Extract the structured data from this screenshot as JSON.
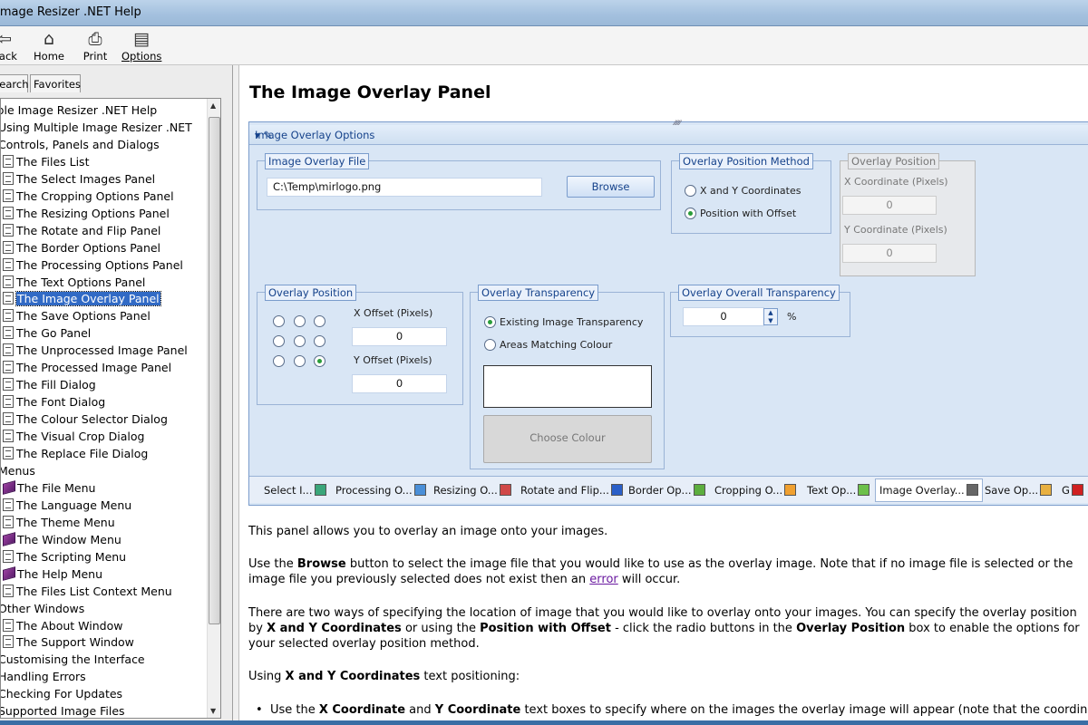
{
  "window": {
    "title": "Image Resizer .NET Help"
  },
  "toolbar": {
    "back": "Back",
    "home": "Home",
    "print": "Print",
    "options": "Options"
  },
  "nav_tabs": {
    "search": "Search",
    "favorites": "Favorites"
  },
  "tree": [
    {
      "label": "Multiple Image Resizer .NET Help",
      "type": "text"
    },
    {
      "label": "Using Multiple Image Resizer .NET",
      "type": "text"
    },
    {
      "label": "Controls, Panels and Dialogs",
      "type": "text"
    },
    {
      "label": "The Files List",
      "type": "page"
    },
    {
      "label": "The Select Images Panel",
      "type": "page"
    },
    {
      "label": "The Cropping Options Panel",
      "type": "page"
    },
    {
      "label": "The Resizing Options Panel",
      "type": "page"
    },
    {
      "label": "The Rotate and Flip Panel",
      "type": "page"
    },
    {
      "label": "The Border Options Panel",
      "type": "page"
    },
    {
      "label": "The Processing Options Panel",
      "type": "page"
    },
    {
      "label": "The Text Options Panel",
      "type": "page"
    },
    {
      "label": "The Image Overlay Panel",
      "type": "page",
      "selected": true
    },
    {
      "label": "The Save Options Panel",
      "type": "page"
    },
    {
      "label": "The Go Panel",
      "type": "page"
    },
    {
      "label": "The Unprocessed Image Panel",
      "type": "page"
    },
    {
      "label": "The Processed Image Panel",
      "type": "page"
    },
    {
      "label": "The Fill Dialog",
      "type": "page"
    },
    {
      "label": "The Font Dialog",
      "type": "page"
    },
    {
      "label": "The Colour Selector Dialog",
      "type": "page"
    },
    {
      "label": "The Visual Crop Dialog",
      "type": "page"
    },
    {
      "label": "The Replace File Dialog",
      "type": "page"
    },
    {
      "label": "Menus",
      "type": "text"
    },
    {
      "label": "The File Menu",
      "type": "book"
    },
    {
      "label": "The Language Menu",
      "type": "page"
    },
    {
      "label": "The Theme Menu",
      "type": "page"
    },
    {
      "label": "The Window Menu",
      "type": "book"
    },
    {
      "label": "The Scripting Menu",
      "type": "page"
    },
    {
      "label": "The Help Menu",
      "type": "book"
    },
    {
      "label": "The Files List Context Menu",
      "type": "page"
    },
    {
      "label": "Other Windows",
      "type": "text"
    },
    {
      "label": "The About Window",
      "type": "page"
    },
    {
      "label": "The Support Window",
      "type": "page"
    },
    {
      "label": "Customising the Interface",
      "type": "text"
    },
    {
      "label": "Handling Errors",
      "type": "text"
    },
    {
      "label": "Checking For Updates",
      "type": "text"
    },
    {
      "label": "Supported Image Files",
      "type": "text"
    }
  ],
  "content": {
    "heading": "The Image Overlay Panel",
    "panel": {
      "title": "Image Overlay Options",
      "overlay_file": {
        "legend": "Image Overlay File",
        "path": "C:\\Temp\\mirlogo.png",
        "browse": "Browse"
      },
      "position_method": {
        "legend": "Overlay Position Method",
        "opt1": "X and Y Coordinates",
        "opt2": "Position with Offset"
      },
      "overlay_position_coords": {
        "legend": "Overlay Position",
        "x_label": "X Coordinate (Pixels)",
        "x_value": "0",
        "y_label": "Y Coordinate (Pixels)",
        "y_value": "0"
      },
      "overlay_position": {
        "legend": "Overlay Position",
        "x_offset_label": "X Offset (Pixels)",
        "x_offset": "0",
        "y_offset_label": "Y Offset (Pixels)",
        "y_offset": "0"
      },
      "transparency": {
        "legend": "Overlay Transparency",
        "opt1": "Existing Image Transparency",
        "opt2": "Areas Matching Colour",
        "choose": "Choose Colour"
      },
      "overall": {
        "legend": "Overlay Overall Transparency",
        "value": "0",
        "unit": "%"
      },
      "tabs": [
        "Select I...",
        "Processing O...",
        "Resizing O...",
        "Rotate and Flip...",
        "Border Op...",
        "Cropping O...",
        "Text Op...",
        "Image Overlay...",
        "Save Op...",
        "G"
      ]
    },
    "p1": "This panel allows you to overlay an image onto your images.",
    "p2a": "Use the ",
    "p2b": "Browse",
    "p2c": " button to select the image file that you would like to use as the overlay image. Note that if no image file is selected or the image file you previously selected does not exist then an ",
    "p2link": "error",
    "p2d": " will occur.",
    "p3a": "There are two ways of specifying the location of image that you would like to overlay onto your images. You can specify the overlay position by ",
    "p3b": "X and Y Coordinates",
    "p3c": " or using the ",
    "p3d": "Position with Offset",
    "p3e": " - click the radio buttons in the ",
    "p3f": "Overlay Position",
    "p3g": " box to enable the options for your selected overlay position method.",
    "p4a": "Using ",
    "p4b": "X and Y Coordinates",
    "p4c": " text positioning:",
    "b1a": "Use the ",
    "b1b": "X Coordinate",
    "b1c": " and ",
    "b1d": "Y Coordinate",
    "b1e": " text boxes to specify where on the images the overlay image will appear (note that the coordinates specified"
  }
}
